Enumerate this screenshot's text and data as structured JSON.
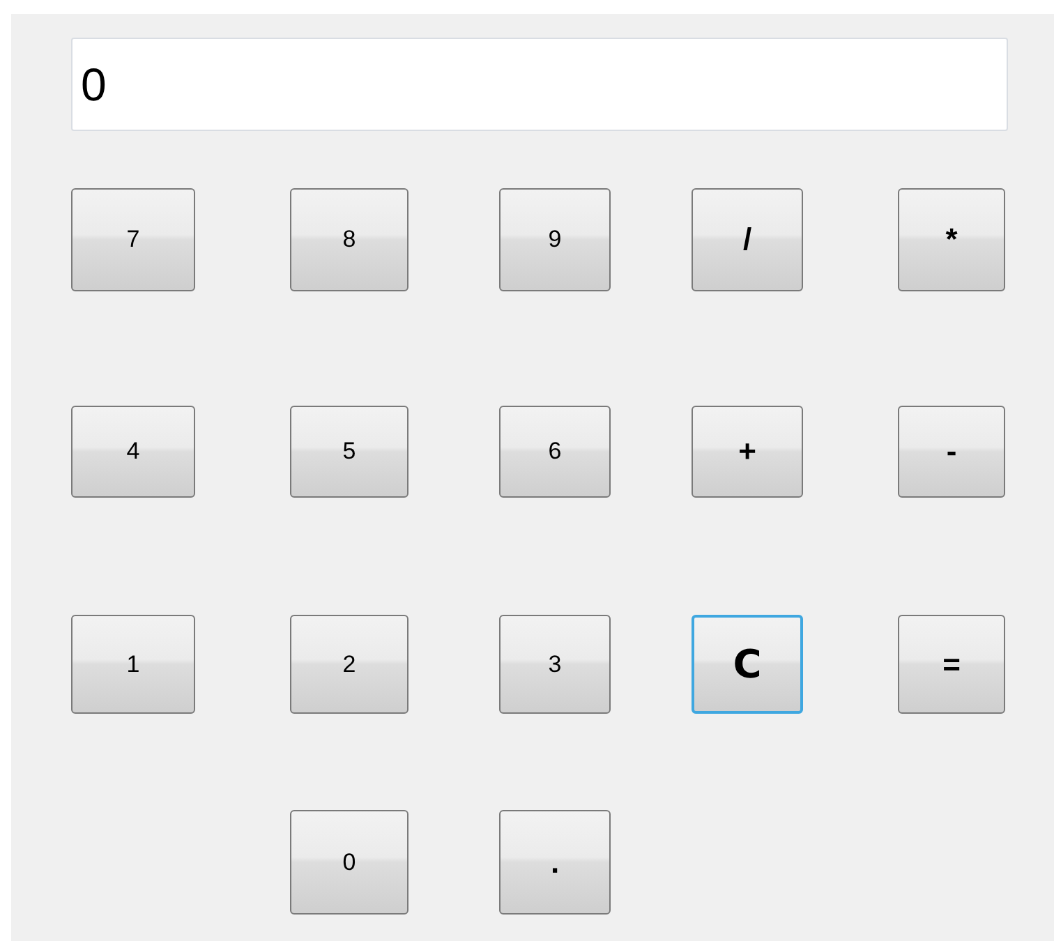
{
  "display": {
    "value": "0"
  },
  "keys": [
    {
      "label": "7",
      "kind": "digit",
      "focused": false
    },
    {
      "label": "8",
      "kind": "digit",
      "focused": false
    },
    {
      "label": "9",
      "kind": "digit",
      "focused": false
    },
    {
      "label": "/",
      "kind": "operator",
      "focused": false
    },
    {
      "label": "*",
      "kind": "operator",
      "focused": false
    },
    {
      "label": "4",
      "kind": "digit",
      "focused": false
    },
    {
      "label": "5",
      "kind": "digit",
      "focused": false
    },
    {
      "label": "6",
      "kind": "digit",
      "focused": false
    },
    {
      "label": "+",
      "kind": "operator",
      "focused": false
    },
    {
      "label": "-",
      "kind": "operator",
      "focused": false
    },
    {
      "label": "1",
      "kind": "digit",
      "focused": false
    },
    {
      "label": "2",
      "kind": "digit",
      "focused": false
    },
    {
      "label": "3",
      "kind": "digit",
      "focused": false
    },
    {
      "label": "C",
      "kind": "clear",
      "focused": true
    },
    {
      "label": "=",
      "kind": "operator",
      "focused": false
    },
    {
      "label": "0",
      "kind": "digit",
      "focused": false
    },
    {
      "label": ".",
      "kind": "operator",
      "focused": false
    }
  ]
}
